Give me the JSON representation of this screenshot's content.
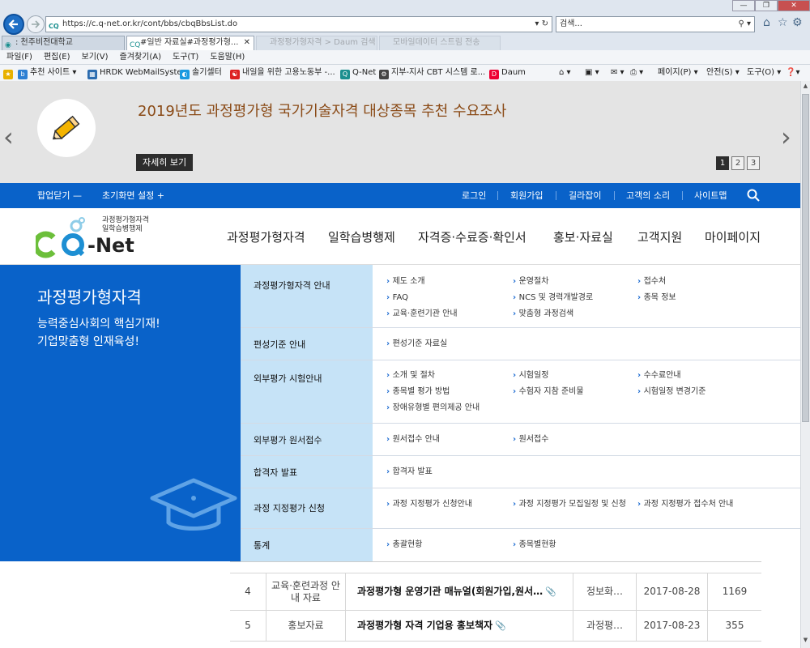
{
  "browser": {
    "address_url": "https://c.q-net.or.kr/cont/bbs/cbqBbsList.do",
    "address_favicon": "CQ",
    "search_placeholder": "검색...",
    "tabs": [
      {
        "label": ": 천주비전대학교"
      },
      {
        "label": "#일반 자료실#과정평가형..."
      },
      {
        "label": "과정평가형자격 > Daum 검색"
      },
      {
        "label": "모바일데이터 스트림 전송"
      }
    ],
    "menu": [
      "파일(F)",
      "편집(E)",
      "보기(V)",
      "즐겨찾기(A)",
      "도구(T)",
      "도움말(H)"
    ],
    "favorites": [
      {
        "label": "추천 사이트 ▾",
        "color": "#2d7fd3"
      },
      {
        "label": "HRDK WebMailSystem",
        "color": "#2b6cb0"
      },
      {
        "label": "솔기셀터",
        "color": "#1a9ae0"
      },
      {
        "label": "내일을 위한 고용노동부 -...",
        "color": "#d22"
      },
      {
        "label": "Q-Net",
        "color": "#1b8f8f"
      },
      {
        "label": "지부-지사 CBT 시스템 로...",
        "color": "#444"
      },
      {
        "label": "Daum",
        "color": "#e03"
      }
    ],
    "cmd": [
      "페이지(P) ▾",
      "안전(S) ▾",
      "도구(O) ▾"
    ]
  },
  "banner": {
    "title": "2019년도 과정평가형 국가기술자격 대상종목 추천 수요조사",
    "more": "자세히 보기",
    "pages": [
      "1",
      "2",
      "3"
    ],
    "active_page": "1"
  },
  "topbar": {
    "left": [
      "팝업닫기 —",
      "초기화면 설정 +"
    ],
    "right": [
      "로그인",
      "회원가입",
      "길라잡이",
      "고객의 소리",
      "사이트맵"
    ]
  },
  "logo": {
    "top_line1": "과정평가형자격",
    "top_line2": "일학습병행제",
    "text": "-Net"
  },
  "gnb": [
    "과정평가형자격",
    "일학습병행제",
    "자격증·수료증·확인서",
    "홍보·자료실",
    "고객지원",
    "마이페이지"
  ],
  "mega": {
    "title": "과정평가형자격",
    "sub1": "능력중심사회의 핵심기재!",
    "sub2": "기업맞춤형 인재육성!",
    "rows": [
      {
        "cat": "과정평가형자격 안내",
        "links": [
          "제도 소개",
          "운영절차",
          "접수처",
          "FAQ",
          "NCS 및 경력개발경로",
          "종목 정보",
          "교육·훈련기관 안내",
          "맞춤형 과정검색"
        ]
      },
      {
        "cat": "편성기준 안내",
        "links": [
          "편성기준 자료실"
        ]
      },
      {
        "cat": "외부평가 시험안내",
        "links": [
          "소개 및 절차",
          "시험일정",
          "수수료안내",
          "종목별 평가 방법",
          "수험자 지참 준비물",
          "시험일정 변경기준",
          "장애유형별 편의제공 안내"
        ]
      },
      {
        "cat": "외부평가 원서접수",
        "links": [
          "원서접수 안내",
          "원서접수"
        ]
      },
      {
        "cat": "합격자 발표",
        "links": [
          "합격자 발표"
        ]
      },
      {
        "cat": "과정 지정평가 신청",
        "links": [
          "과정 지정평가 신청안내",
          "과정 지정평가 모집일정 및 신청",
          "과정 지정평가 접수처 안내"
        ]
      },
      {
        "cat": "통계",
        "links": [
          "총괄현황",
          "종목별현황"
        ]
      }
    ]
  },
  "table": {
    "rows": [
      {
        "no": "4",
        "cat": "교육·훈련과정 안내 자료",
        "title": "과정평가형 운영기관 매뉴얼(회원가입,원서…",
        "writer": "정보화…",
        "date": "2017-08-28",
        "views": "1169"
      },
      {
        "no": "5",
        "cat": "홍보자료",
        "title": "과정평가형 자격 기업용 홍보책자",
        "writer": "과정평…",
        "date": "2017-08-23",
        "views": "355"
      }
    ]
  }
}
